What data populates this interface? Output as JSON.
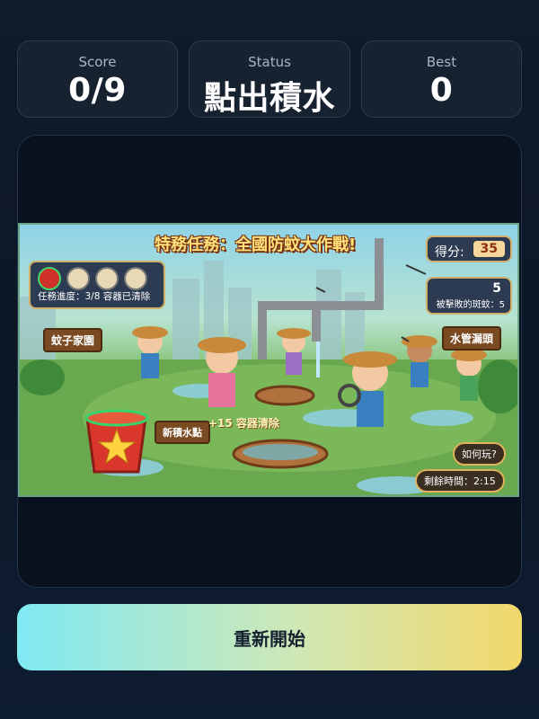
{
  "stats": {
    "score_label": "Score",
    "score_value": "0/9",
    "status_label": "Status",
    "status_value": "點出積水",
    "best_label": "Best",
    "best_value": "0"
  },
  "scene": {
    "title": "特務任務：全國防蚊大作戰!",
    "score_label": "得分:",
    "score_value": "35",
    "defeated_value": "5",
    "defeated_label": "被擊敗的斑蚊：5",
    "task_progress": "任務進度：3/8 容器已清除",
    "task_icons": [
      "bucket-icon",
      "can-icon",
      "bowl-icon",
      "tire-icon"
    ],
    "sign_mosquito_home": "蚊子家園",
    "sign_pipe_leak": "水管漏頭",
    "sign_new_water": "新積水點",
    "floating_bonus": "+15 容器清除",
    "how_to_play": "如何玩?",
    "time_remaining": "剩餘時間：2:15"
  },
  "restart_label": "重新開始",
  "colors": {
    "accent_start": "#7fe9f2",
    "accent_end": "#f2d86a",
    "panel_bg": "#08111d",
    "stat_bg": "#172231"
  }
}
